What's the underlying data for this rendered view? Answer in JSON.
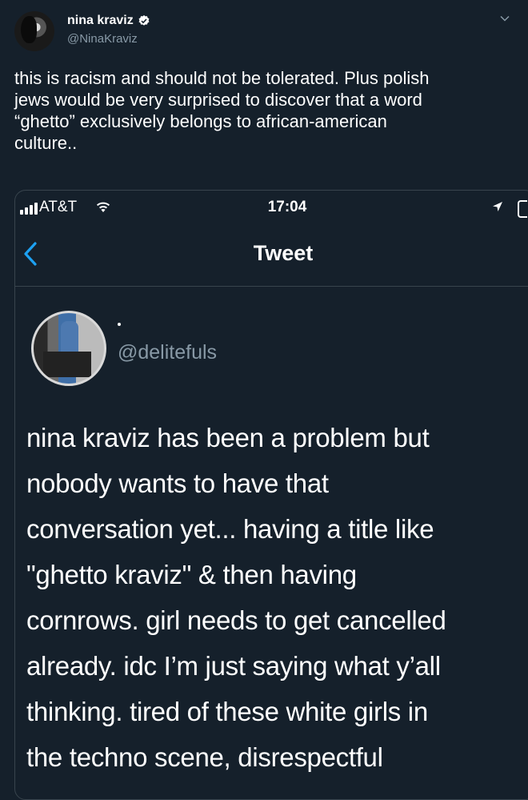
{
  "tweet": {
    "display_name": "nina kraviz",
    "verified": true,
    "handle": "@NinaKraviz",
    "icons": {
      "verified": "verified-badge-icon",
      "menu": "chevron-down-icon"
    },
    "text": "this is racism and should not be tolerated. Plus polish\njews would be very surprised to discover that a word\n“ghetto” exclusively belongs to african-american\nculture.."
  },
  "embedded_screenshot": {
    "status_bar": {
      "carrier": "AT&T",
      "time": "17:04",
      "icons": [
        "signal-icon",
        "wifi-icon",
        "location-arrow-icon",
        "battery-icon"
      ]
    },
    "nav": {
      "title": "Tweet",
      "back_icon": "back-chevron-icon"
    },
    "author": {
      "name": ".",
      "handle": "@delitefuls"
    },
    "text": "nina kraviz has been a problem but\nnobody wants to have that\nconversation yet... having a title like\n\"ghetto kraviz\" & then having\ncornrows. girl needs to get cancelled\nalready. idc I’m just saying what y’all\nthinking. tired of these white girls in\nthe techno scene, disrespectful"
  },
  "colors": {
    "background": "#15202b",
    "text_primary": "#ffffff",
    "text_secondary": "#8899a6",
    "border": "#38444d",
    "accent": "#1da1f2"
  }
}
